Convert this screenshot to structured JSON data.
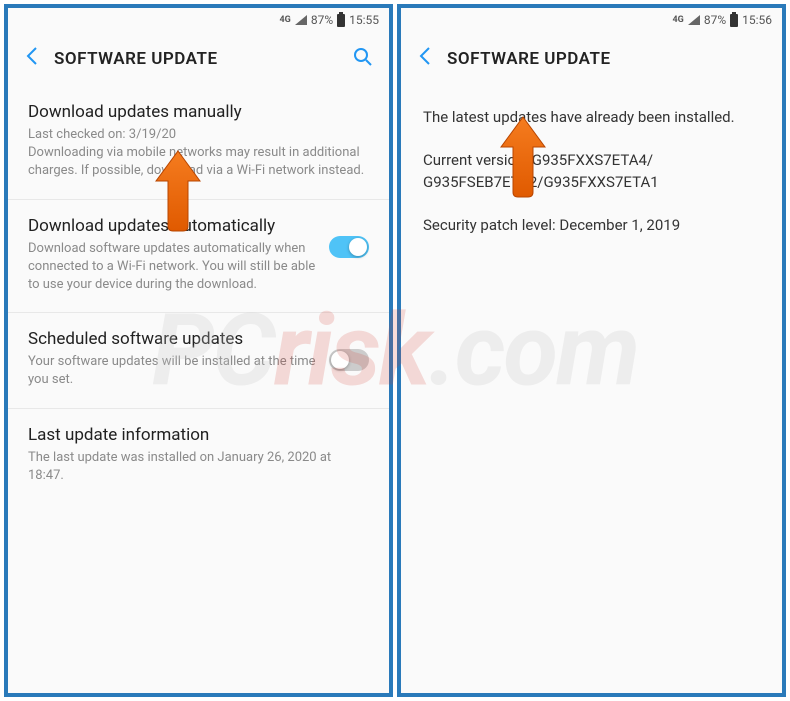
{
  "status_bar": {
    "network": "4G",
    "battery_percent": "87%",
    "time_left": "15:55",
    "time_right": "15:56"
  },
  "left": {
    "header_title": "SOFTWARE UPDATE",
    "sections": {
      "manual": {
        "title": "Download updates manually",
        "desc": "Last checked on: 3/19/20\nDownloading via mobile networks may result in additional charges. If possible, download via a Wi-Fi network instead."
      },
      "auto": {
        "title": "Download updates automatically",
        "desc": "Download software updates automatically when connected to a Wi-Fi network. You will still be able to use your device during the download.",
        "toggle": true
      },
      "scheduled": {
        "title": "Scheduled software updates",
        "desc": "Your software updates will be installed at the time you set.",
        "toggle": false
      },
      "last_info": {
        "title": "Last update information",
        "desc": "The last update was installed on January 26, 2020 at 18:47."
      }
    }
  },
  "right": {
    "header_title": "SOFTWARE UPDATE",
    "info": {
      "message": "The latest updates have already been installed.",
      "version_label": "Current version:",
      "version_line1": "G935FXXS7ETA4/",
      "version_line2": "G935FSEB7ETA2/G935FXXS7ETA1",
      "security_label": "Security patch level: December 1, 2019"
    }
  },
  "watermark": {
    "p1": "PC",
    "p2": "risk",
    "p3": ".com"
  }
}
